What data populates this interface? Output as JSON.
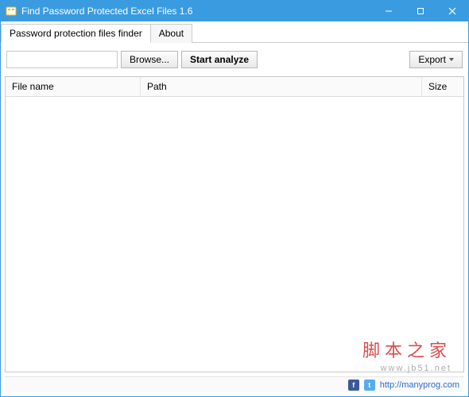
{
  "titlebar": {
    "title": "Find Password Protected Excel Files 1.6"
  },
  "tabs": {
    "finder": "Password protection files finder",
    "about": "About"
  },
  "toolbar": {
    "path_value": "",
    "browse_label": "Browse...",
    "analyze_label": "Start analyze",
    "export_label": "Export"
  },
  "grid": {
    "columns": {
      "file": "File name",
      "path": "Path",
      "size": "Size"
    },
    "rows": []
  },
  "footer": {
    "link_text": "http://manyprog.com"
  },
  "watermark": {
    "line1": "脚本之家",
    "line2": "www.jb51.net"
  }
}
